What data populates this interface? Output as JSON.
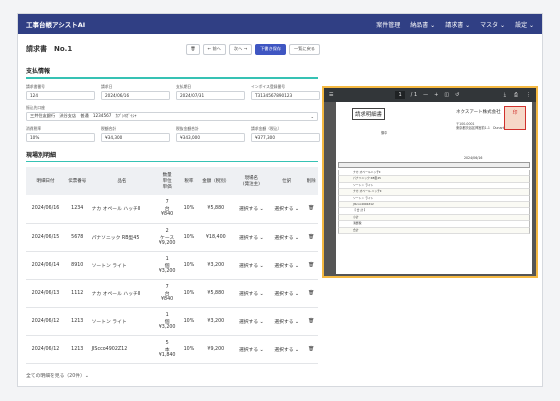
{
  "app": {
    "title": "工事台帳アシストAI"
  },
  "nav": [
    "案件管理",
    "納品書 ⌄",
    "請求書 ⌄",
    "マスタ ⌄",
    "設定 ⌄"
  ],
  "header": {
    "title": "請求書　No.1",
    "prev": "← 前へ",
    "next": "次へ →",
    "save_draft": "下書き保存",
    "back": "一覧に戻る"
  },
  "payment": {
    "section": "支払情報",
    "fields": [
      {
        "label": "請求書番号",
        "value": "124"
      },
      {
        "label": "請求日",
        "value": "2024/06/16"
      },
      {
        "label": "支払期日",
        "value": "2024/07/31"
      },
      {
        "label": "インボイス登録番号",
        "value": "T3134567890123"
      }
    ],
    "bank": {
      "label": "振込先口座",
      "value": "三井住友銀行　渋谷支店　普通　1234567　ｶﾌﾞｼｷｶﾞｲｼｬ"
    },
    "amounts": [
      {
        "label": "消費税率",
        "value": "10%"
      },
      {
        "label": "税額合計",
        "value": "¥34,300"
      },
      {
        "label": "税抜金額合計",
        "value": "¥343,000"
      },
      {
        "label": "請求金額（税込）",
        "value": "¥377,300"
      }
    ]
  },
  "details": {
    "section": "現場別明細",
    "columns": [
      "明細日付",
      "伝票番号",
      "品名",
      "数量\n単位\n単価",
      "税率",
      "金額（税別）",
      "現場名\n(発注主)",
      "仕訳",
      "削除"
    ],
    "rows": [
      {
        "date": "2024/06/16",
        "slip": "1234",
        "item": "ナカ オペール ハッチⅡ",
        "qty": "7",
        "unit": "台",
        "price": "¥840",
        "tax": "10%",
        "amount": "¥5,880",
        "site": "選択する ⌄",
        "journal": "選択する ⌄"
      },
      {
        "date": "2024/06/15",
        "slip": "5678",
        "item": "パナソニック RB型45",
        "qty": "2",
        "unit": "ケース",
        "price": "¥9,200",
        "tax": "10%",
        "amount": "¥18,400",
        "site": "選択する ⌄",
        "journal": "選択する ⌄"
      },
      {
        "date": "2024/06/14",
        "slip": "8910",
        "item": "ソートン ライト",
        "qty": "1",
        "unit": "個",
        "price": "¥3,200",
        "tax": "10%",
        "amount": "¥3,200",
        "site": "選択する ⌄",
        "journal": "選択する ⌄"
      },
      {
        "date": "2024/06/13",
        "slip": "1112",
        "item": "ナカ オペール ハッチⅡ",
        "qty": "7",
        "unit": "台",
        "price": "¥840",
        "tax": "10%",
        "amount": "¥5,880",
        "site": "選択する ⌄",
        "journal": "選択する ⌄"
      },
      {
        "date": "2024/06/12",
        "slip": "1213",
        "item": "ソートン ライト",
        "qty": "1",
        "unit": "個",
        "price": "¥3,200",
        "tax": "10%",
        "amount": "¥3,200",
        "site": "選択する ⌄",
        "journal": "選択する ⌄"
      },
      {
        "date": "2024/06/12",
        "slip": "1213",
        "item": "JIScco4902Z12",
        "qty": "5",
        "unit": "本",
        "price": "¥1,840",
        "tax": "10%",
        "amount": "¥9,200",
        "site": "選択する ⌄",
        "journal": "選択する ⌄"
      }
    ],
    "more": "全ての明細を見る（20件）⌄"
  },
  "pdf": {
    "page": "1",
    "pages": "/ 1",
    "doc_title": "請求明細書",
    "company": "ネクスアート株式会社",
    "addr1": "〒100-0001",
    "addr2": "東京都渋谷区神宮前1-1　Dunart-ing 4階",
    "num": "御中",
    "date": "2024/06/16",
    "stamp": "印",
    "rows": [
      "ナカ オペールハッチⅡ",
      "パナソニック RB型45",
      "ソートン ライト",
      "ナカ オペール ハッチⅡ",
      "ソートン ライト",
      "JIScco4902Z12",
      "【 合 計 】",
      "小計",
      "消費税",
      "合計"
    ]
  }
}
